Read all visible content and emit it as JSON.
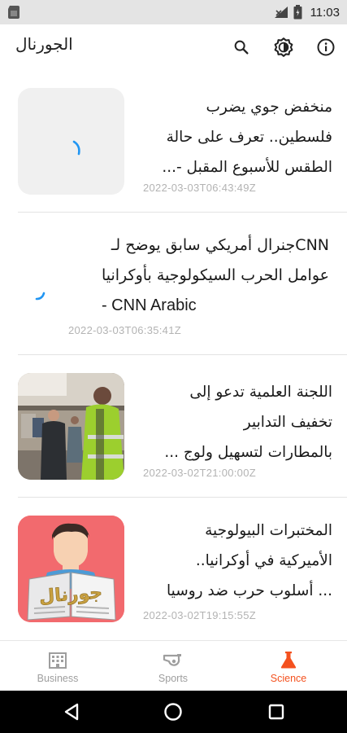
{
  "status_bar": {
    "time": "11:03",
    "icons": [
      "sim-card-icon",
      "signal-icon",
      "battery-icon"
    ]
  },
  "app_bar": {
    "title": "الجورنال",
    "actions": [
      "search-icon",
      "brightness-icon",
      "info-icon"
    ]
  },
  "articles": [
    {
      "title_lines": [
        "منخفض جوي يضرب",
        "فلسطين.. تعرف على حالة",
        "الطقس للأسبوع المقبل -..."
      ],
      "date": "2022-03-03T06:43:49Z",
      "image": "loading-placeholder"
    },
    {
      "title_lines": [
        "CNNجنرال أمريكي سابق يوضح لـ",
        "عوامل الحرب السيكولوجية بأوكرانيا",
        "- CNN Arabic"
      ],
      "date": "2022-03-03T06:35:41Z",
      "image": "loading-spinner"
    },
    {
      "title_lines": [
        "اللجنة العلمية تدعو إلى",
        "تخفيف التدابير",
        "بالمطارات لتسهيل ولوج ..."
      ],
      "date": "2022-03-02T21:00:00Z",
      "image": "airport-photo"
    },
    {
      "title_lines": [
        "المختبرات البيولوجية",
        "الأميركية في أوكرانيا..",
        "... أسلوب حرب ضد روسيا"
      ],
      "date": "2022-03-02T19:15:55Z",
      "image": "newspaper-logo",
      "image_text": "جورنال"
    }
  ],
  "bottom_nav": {
    "items": [
      {
        "label": "Business",
        "icon": "building-icon",
        "active": false
      },
      {
        "label": "Sports",
        "icon": "whistle-icon",
        "active": false
      },
      {
        "label": "Science",
        "icon": "flask-icon",
        "active": true
      }
    ],
    "active_color": "#f4511e",
    "inactive_color": "#9e9e9e"
  },
  "system_nav": [
    "back-icon",
    "home-icon",
    "recents-icon"
  ]
}
